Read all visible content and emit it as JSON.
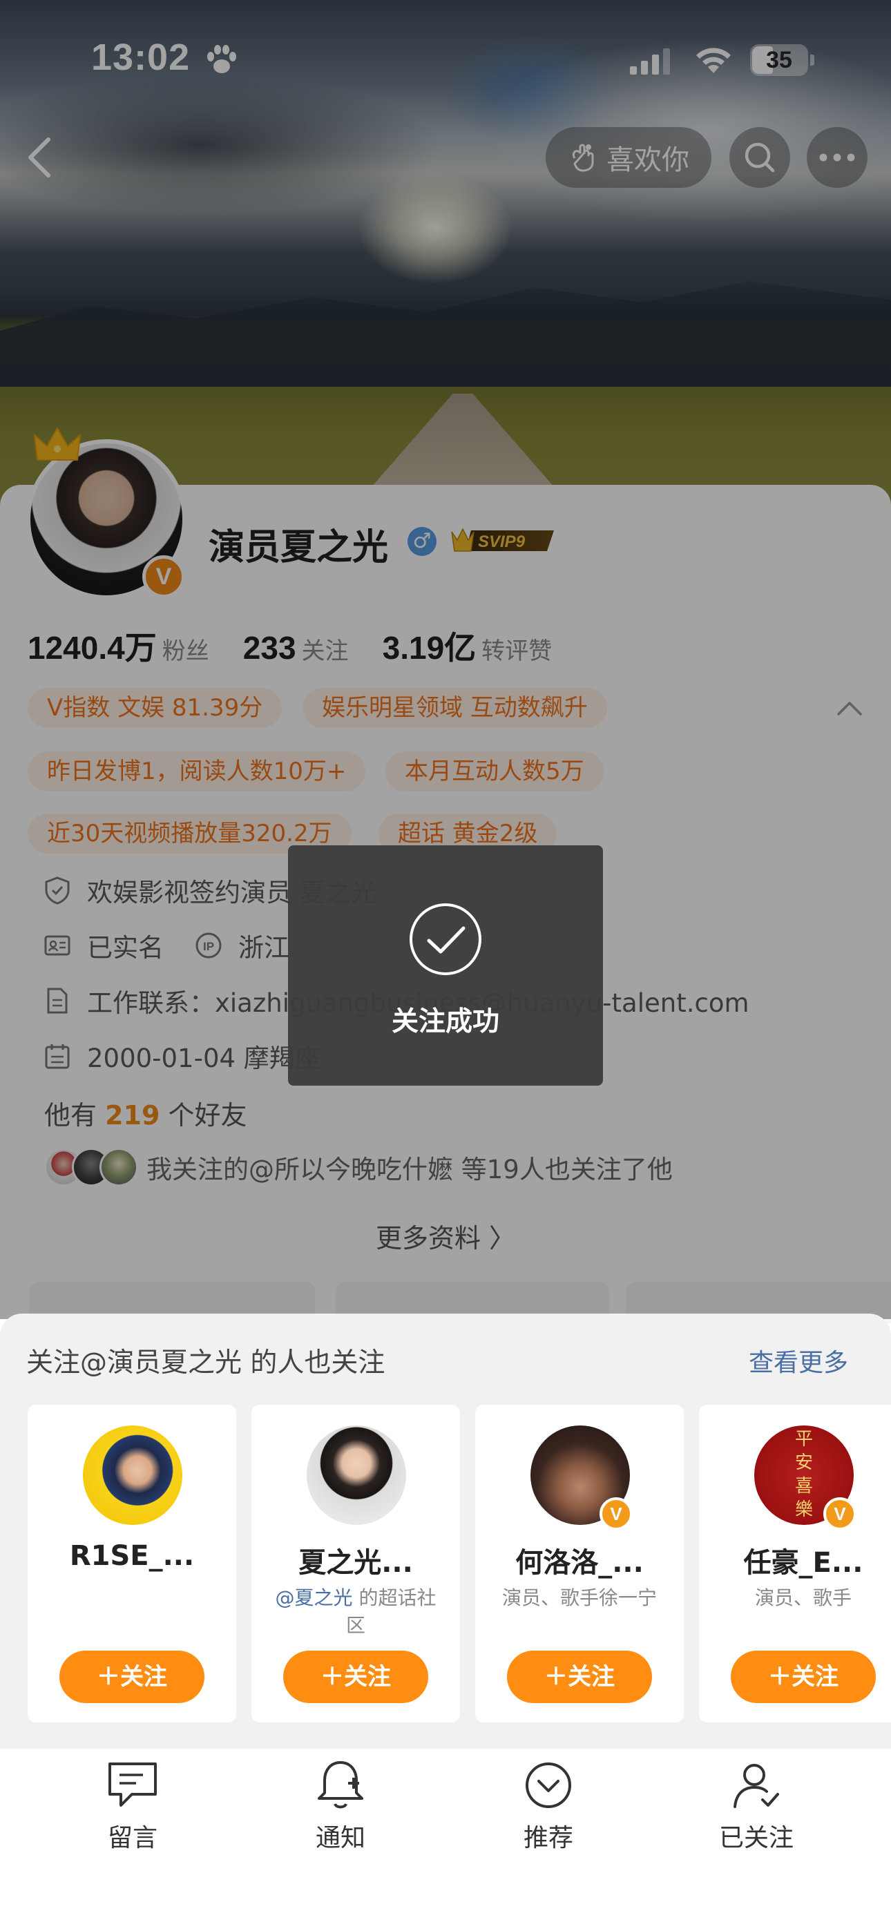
{
  "status_bar": {
    "time": "13:02",
    "battery": "35"
  },
  "header": {
    "like_label": "喜欢你"
  },
  "profile": {
    "name": "演员夏之光",
    "vip_label": "SVIP9",
    "verified_badge": "V",
    "stats": [
      {
        "value": "1240.4万",
        "label": "粉丝"
      },
      {
        "value": "233",
        "label": "关注"
      },
      {
        "value": "3.19亿",
        "label": "转评赞"
      }
    ],
    "tags": [
      "V指数 文娱 81.39分",
      "娱乐明星领域 互动数飙升",
      "昨日发博1，阅读人数10万+",
      "本月互动人数5万",
      "近30天视频播放量320.2万",
      "超话 黄金2级"
    ],
    "info": {
      "signed": "欢娱影视签约演员 夏之光",
      "realname": "已实名",
      "ip": "浙江",
      "contact": "工作联系：xiazhiguangbusiness@huanyu-talent.com",
      "birthday": "2000-01-04 摩羯座"
    },
    "friends_prefix": "他有",
    "friends_count": "219",
    "friends_suffix": "个好友",
    "mutual_text": "我关注的@所以今晚吃什嬷 等19人也关注了他",
    "more_info": "更多资料 〉"
  },
  "toast": {
    "message": "关注成功"
  },
  "recommend": {
    "title": "关注@演员夏之光 的人也关注",
    "more": "查看更多",
    "follow_label": "＋关注",
    "items": [
      {
        "name": "R1SE_...",
        "desc": ""
      },
      {
        "name": "夏之光...",
        "desc_at": "@夏之光",
        "desc": " 的超话社区"
      },
      {
        "name": "何洛洛_...",
        "desc": "演员、歌手徐一宁"
      },
      {
        "name": "任豪_E...",
        "desc": "演员、歌手"
      }
    ]
  },
  "toolbar": {
    "items": [
      {
        "label": "留言",
        "icon": "message-icon"
      },
      {
        "label": "通知",
        "icon": "bell-plus-icon"
      },
      {
        "label": "推荐",
        "icon": "chevron-circle-icon"
      },
      {
        "label": "已关注",
        "icon": "user-check-icon"
      }
    ]
  },
  "colors": {
    "accent": "#ff8d12",
    "tag_text": "#f0741e",
    "tag_bg": "#fff2e6",
    "link": "#4a6fa5"
  }
}
